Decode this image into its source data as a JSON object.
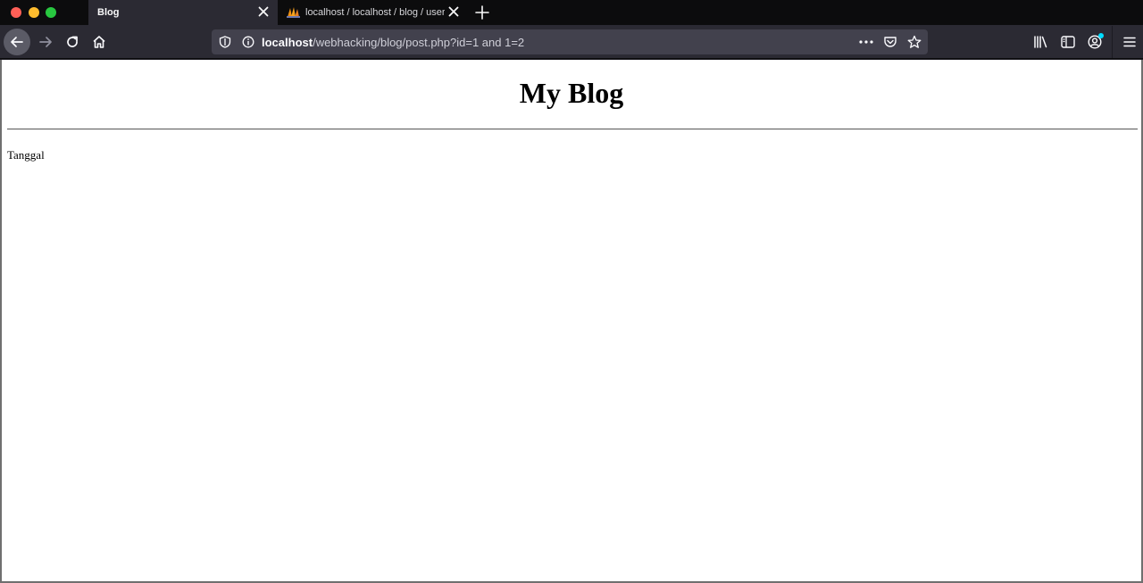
{
  "browser": {
    "tabs": [
      {
        "title": "Blog",
        "active": true
      },
      {
        "title": "localhost / localhost / blog / users | phpMyAdmin",
        "active": false
      }
    ],
    "url": {
      "host": "localhost",
      "path": "/webhacking/blog/post.php?id=1 and 1=2"
    },
    "icons": {
      "back": "back-arrow-icon",
      "forward": "forward-arrow-icon",
      "reload": "reload-icon",
      "home": "home-icon",
      "tracking": "shield-icon",
      "info": "info-icon",
      "more": "more-dots-icon",
      "pocket": "pocket-icon",
      "bookmark": "star-icon",
      "library": "library-icon",
      "sidebar": "sidebar-icon",
      "account": "account-icon",
      "menu": "hamburger-menu-icon"
    },
    "colors": {
      "chrome": "#2b2a33",
      "tabstrip": "#0c0c0d",
      "urlbar": "#42414d",
      "notification_dot": "#00ddff"
    }
  },
  "page": {
    "heading": "My Blog",
    "text": "Tanggal"
  }
}
